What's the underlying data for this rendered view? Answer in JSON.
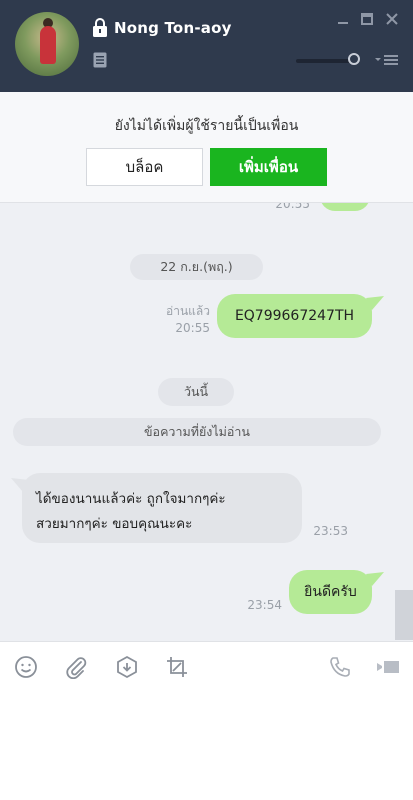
{
  "header": {
    "contact_name": "Nong Ton-aoy"
  },
  "notice": {
    "text": "ยังไม่ได้เพิ่มผู้ใช้รายนี้เป็นเพื่อน",
    "block_label": "บล็อค",
    "add_friend_label": "เพิ่มเพื่อน"
  },
  "chat": {
    "partial_time": "20:55",
    "date_divider": "22 ก.ย.(พฤ.)",
    "msg1": {
      "text": "EQ799667247TH",
      "read": "อ่านแล้ว",
      "time": "20:55"
    },
    "today_divider": "วันนี้",
    "unread_divider": "ข้อความที่ยังไม่อ่าน",
    "msg2": {
      "line1": "ได้ของนานแล้วค่ะ ถูกใจมากๆค่ะ",
      "line2": "สวยมากๆค่ะ ขอบคุณนะคะ",
      "time": "23:53"
    },
    "msg3": {
      "text": "ยินดีครับ",
      "time": "23:54"
    }
  },
  "toolbar": {
    "icons": [
      "emoji-icon",
      "attach-icon",
      "keep-icon",
      "screenshot-icon",
      "call-icon",
      "video-call-icon"
    ]
  },
  "colors": {
    "header_bg": "#2f3a4d",
    "accent_green": "#1ab51f",
    "outgoing_bubble": "#b5ea96",
    "chat_bg": "#eef0f4"
  }
}
